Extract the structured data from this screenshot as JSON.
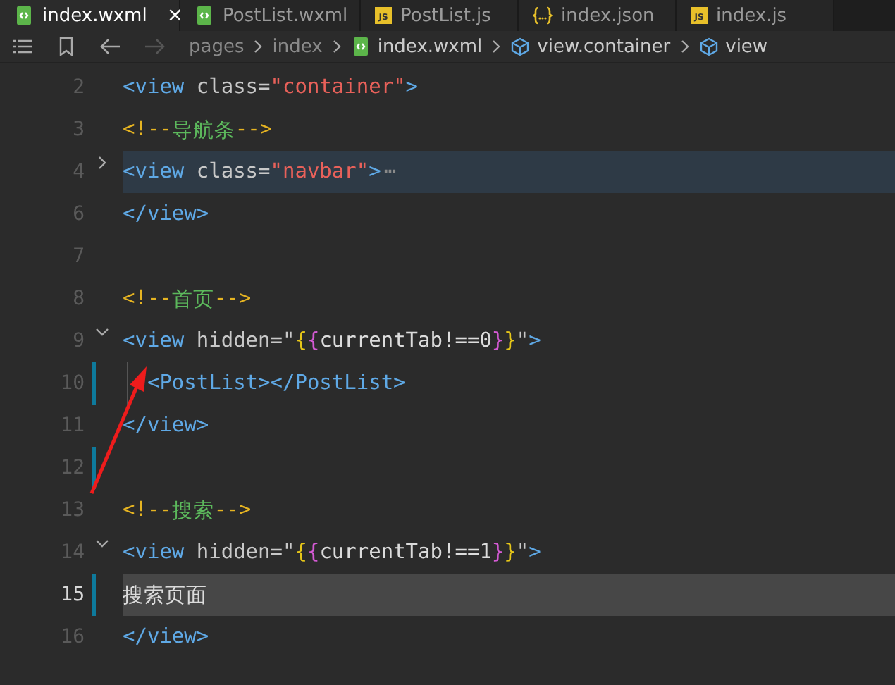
{
  "tabs": [
    {
      "label": "index.wxml",
      "kind": "wxml",
      "selected": true,
      "close": "×"
    },
    {
      "label": "PostList.wxml",
      "kind": "wxml",
      "selected": false
    },
    {
      "label": "PostList.js",
      "kind": "js",
      "badge": "JS",
      "selected": false
    },
    {
      "label": "index.json",
      "kind": "json",
      "selected": false
    },
    {
      "label": "index.js",
      "kind": "js",
      "badge": "JS",
      "selected": false
    }
  ],
  "breadcrumb": [
    {
      "label": "pages",
      "kind": "folder"
    },
    {
      "label": "index",
      "kind": "folder"
    },
    {
      "label": "index.wxml",
      "kind": "file"
    },
    {
      "label": "view.container",
      "kind": "element"
    },
    {
      "label": "view",
      "kind": "element"
    }
  ],
  "lines": [
    {
      "number": "2",
      "foldable": false,
      "expanded": false,
      "changed": false,
      "current": false,
      "guide": false,
      "tokens": [
        {
          "kind": "tag",
          "text": "<view"
        },
        {
          "kind": "attr",
          "text": " class="
        },
        {
          "kind": "string",
          "text": "\"container\""
        },
        {
          "kind": "tag",
          "text": ">"
        }
      ]
    },
    {
      "number": "3",
      "foldable": false,
      "expanded": false,
      "changed": false,
      "current": false,
      "guide": false,
      "tokens": [
        {
          "kind": "punct",
          "text": "<!--"
        },
        {
          "kind": "comment",
          "text": "导航条"
        },
        {
          "kind": "punct",
          "text": "-->"
        }
      ]
    },
    {
      "number": "4",
      "foldable": true,
      "expanded": false,
      "changed": false,
      "current": false,
      "guide": false,
      "tokens": [
        {
          "kind": "tag",
          "text": "<view"
        },
        {
          "kind": "attr",
          "text": " class="
        },
        {
          "kind": "string",
          "text": "\"navbar\""
        },
        {
          "kind": "tag",
          "text": ">"
        },
        {
          "kind": "ellipsis",
          "text": "⋯"
        }
      ]
    },
    {
      "number": "6",
      "foldable": false,
      "expanded": false,
      "changed": false,
      "current": false,
      "guide": false,
      "tokens": [
        {
          "kind": "tag",
          "text": "</view>"
        }
      ]
    },
    {
      "number": "7",
      "foldable": false,
      "expanded": false,
      "changed": false,
      "current": false,
      "guide": false
    },
    {
      "number": "8",
      "foldable": false,
      "expanded": false,
      "changed": false,
      "current": false,
      "guide": false,
      "tokens": [
        {
          "kind": "punct",
          "text": "<!--"
        },
        {
          "kind": "comment",
          "text": "首页"
        },
        {
          "kind": "punct",
          "text": "-->"
        }
      ]
    },
    {
      "number": "9",
      "foldable": true,
      "expanded": true,
      "changed": false,
      "current": false,
      "guide": false,
      "tokens": [
        {
          "kind": "tag",
          "text": "<view"
        },
        {
          "kind": "attr",
          "text": " hidden=\""
        },
        {
          "kind": "brace1",
          "text": "{"
        },
        {
          "kind": "brace2",
          "text": "{"
        },
        {
          "kind": "plain",
          "text": "currentTab!==0"
        },
        {
          "kind": "brace2",
          "text": "}"
        },
        {
          "kind": "brace1",
          "text": "}"
        },
        {
          "kind": "attr",
          "text": "\""
        },
        {
          "kind": "tag",
          "text": ">"
        }
      ]
    },
    {
      "number": "10",
      "foldable": false,
      "expanded": false,
      "changed": true,
      "current": false,
      "guide": true,
      "tokens": [
        {
          "kind": "tag",
          "text": "  <PostList></PostList>"
        }
      ]
    },
    {
      "number": "11",
      "foldable": false,
      "expanded": false,
      "changed": false,
      "current": false,
      "guide": false,
      "tokens": [
        {
          "kind": "tag",
          "text": "</view>"
        }
      ]
    },
    {
      "number": "12",
      "foldable": false,
      "expanded": false,
      "changed": true,
      "current": false,
      "guide": false
    },
    {
      "number": "13",
      "foldable": false,
      "expanded": false,
      "changed": false,
      "current": false,
      "guide": false,
      "tokens": [
        {
          "kind": "punct",
          "text": "<!--"
        },
        {
          "kind": "comment",
          "text": "搜索"
        },
        {
          "kind": "punct",
          "text": "-->"
        }
      ]
    },
    {
      "number": "14",
      "foldable": true,
      "expanded": true,
      "changed": false,
      "current": false,
      "guide": false,
      "tokens": [
        {
          "kind": "tag",
          "text": "<view"
        },
        {
          "kind": "attr",
          "text": " hidden=\""
        },
        {
          "kind": "brace1",
          "text": "{"
        },
        {
          "kind": "brace2",
          "text": "{"
        },
        {
          "kind": "plain",
          "text": "currentTab!==1"
        },
        {
          "kind": "brace2",
          "text": "}"
        },
        {
          "kind": "brace1",
          "text": "}"
        },
        {
          "kind": "attr",
          "text": "\""
        },
        {
          "kind": "tag",
          "text": ">"
        }
      ]
    },
    {
      "number": "15",
      "foldable": false,
      "expanded": false,
      "changed": true,
      "current": true,
      "guide": false,
      "tokens": [
        {
          "kind": "plain",
          "text": "搜索页面"
        }
      ]
    },
    {
      "number": "16",
      "foldable": false,
      "expanded": false,
      "changed": false,
      "current": false,
      "guide": false,
      "tokens": [
        {
          "kind": "tag",
          "text": "</view>"
        }
      ]
    }
  ]
}
